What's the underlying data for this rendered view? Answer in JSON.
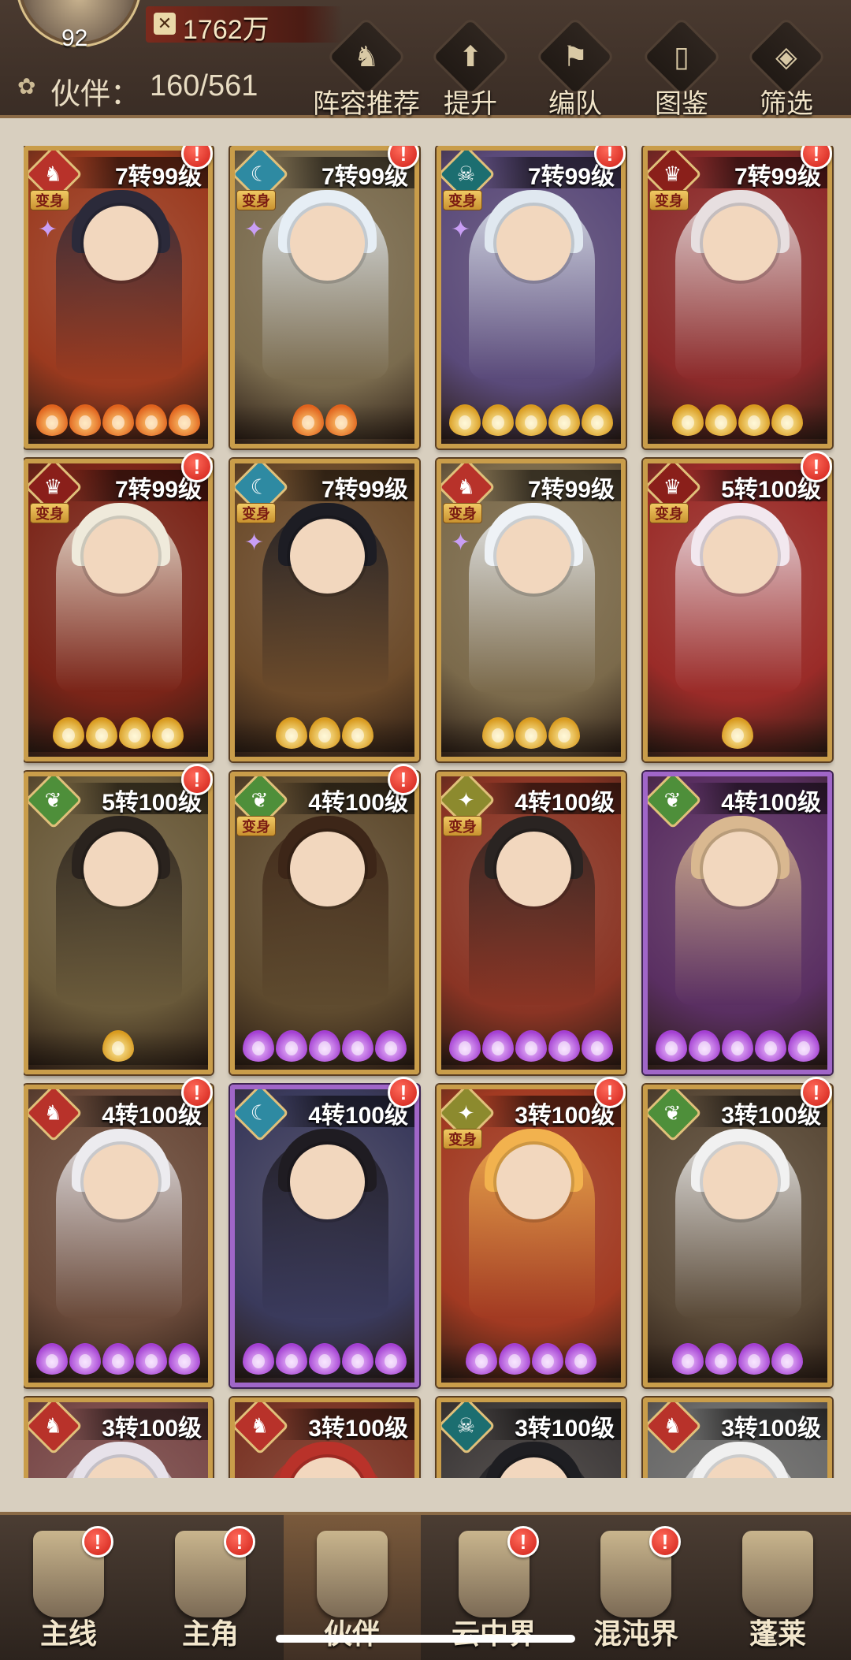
{
  "header": {
    "player_level": "92",
    "power": "1762万",
    "partners_label": "伙伴：",
    "partners_count": "160/561",
    "toolbar": [
      {
        "label": "阵容推荐",
        "icon": "formation-recommend-icon",
        "glyph": "♞"
      },
      {
        "label": "提升",
        "icon": "upgrade-icon",
        "glyph": "⬆"
      },
      {
        "label": "编队",
        "icon": "team-icon",
        "glyph": "⚑"
      },
      {
        "label": "图鉴",
        "icon": "codex-icon",
        "glyph": "▯"
      },
      {
        "label": "筛选",
        "icon": "filter-icon",
        "glyph": "◈"
      }
    ]
  },
  "cards": [
    {
      "level": "7转99级",
      "element": "fox",
      "transform": true,
      "sparkle": true,
      "flames": 5,
      "flame_color": "orange",
      "alert": true,
      "theme": "#9b3a1f",
      "hair": "#2b2a3a"
    },
    {
      "level": "7转99级",
      "element": "moon",
      "transform": true,
      "sparkle": true,
      "flames": 2,
      "flame_color": "orange",
      "alert": true,
      "theme": "#7a6b4e",
      "hair": "#e6eef5"
    },
    {
      "level": "7转99级",
      "element": "demon",
      "transform": true,
      "sparkle": true,
      "flames": 5,
      "flame_color": "gold",
      "alert": true,
      "theme": "#5a4a7a",
      "hair": "#e0e8f0"
    },
    {
      "level": "7转99级",
      "element": "beast",
      "transform": true,
      "sparkle": false,
      "flames": 4,
      "flame_color": "gold",
      "alert": true,
      "theme": "#8c2a2a",
      "hair": "#e7dfe0"
    },
    {
      "level": "7转99级",
      "element": "beast",
      "transform": true,
      "sparkle": false,
      "flames": 4,
      "flame_color": "gold",
      "alert": true,
      "theme": "#7a2418",
      "hair": "#efeadb"
    },
    {
      "level": "7转99级",
      "element": "moon",
      "transform": true,
      "sparkle": true,
      "flames": 3,
      "flame_color": "gold",
      "alert": false,
      "theme": "#6b4a2a",
      "hair": "#1d1d24"
    },
    {
      "level": "7转99级",
      "element": "fox",
      "transform": true,
      "sparkle": true,
      "flames": 3,
      "flame_color": "gold",
      "alert": false,
      "theme": "#7b6a4b",
      "hair": "#eef2f6"
    },
    {
      "level": "5转100级",
      "element": "beast",
      "transform": true,
      "sparkle": false,
      "flames": 1,
      "flame_color": "gold",
      "alert": true,
      "theme": "#9a2b28",
      "hair": "#f2e8ef"
    },
    {
      "level": "5转100级",
      "element": "leaf",
      "transform": false,
      "sparkle": false,
      "flames": 1,
      "flame_color": "gold",
      "alert": true,
      "theme": "#6a5a3a",
      "hair": "#2a231e"
    },
    {
      "level": "4转100级",
      "element": "leaf",
      "transform": true,
      "sparkle": false,
      "flames": 5,
      "flame_color": "purple",
      "alert": true,
      "theme": "#5e4a2e",
      "hair": "#3d2618"
    },
    {
      "level": "4转100级",
      "element": "gold",
      "transform": true,
      "sparkle": false,
      "flames": 5,
      "flame_color": "purple",
      "alert": false,
      "theme": "#8a3424",
      "hair": "#2a2422"
    },
    {
      "level": "4转100级",
      "element": "leaf",
      "transform": false,
      "sparkle": false,
      "flames": 5,
      "flame_color": "purple",
      "alert": false,
      "theme": "#5a2f62",
      "hair": "#d9b890",
      "purple": true
    },
    {
      "level": "4转100级",
      "element": "fox",
      "transform": false,
      "sparkle": false,
      "flames": 5,
      "flame_color": "purple",
      "alert": true,
      "theme": "#6a4a3a",
      "hair": "#ecebef"
    },
    {
      "level": "4转100级",
      "element": "moon",
      "transform": false,
      "sparkle": false,
      "flames": 5,
      "flame_color": "purple",
      "alert": true,
      "theme": "#3a3a5c",
      "hair": "#1f1c22",
      "purple": true
    },
    {
      "level": "3转100级",
      "element": "gold",
      "transform": true,
      "sparkle": false,
      "flames": 4,
      "flame_color": "purple",
      "alert": true,
      "theme": "#a23a22",
      "hair": "#f2b24e"
    },
    {
      "level": "3转100级",
      "element": "leaf",
      "transform": false,
      "sparkle": false,
      "flames": 4,
      "flame_color": "purple",
      "alert": true,
      "theme": "#5a4a38",
      "hair": "#f1f1f1"
    },
    {
      "level": "3转100级",
      "element": "fox",
      "transform": false,
      "sparkle": false,
      "flames": 0,
      "flame_color": "purple",
      "alert": false,
      "theme": "#7a4a4a",
      "hair": "#e7e2ea"
    },
    {
      "level": "3转100级",
      "element": "fox",
      "transform": false,
      "sparkle": false,
      "flames": 0,
      "flame_color": "purple",
      "alert": false,
      "theme": "#7a3526",
      "hair": "#b9322a"
    },
    {
      "level": "3转100级",
      "element": "demon",
      "transform": false,
      "sparkle": false,
      "flames": 0,
      "flame_color": "purple",
      "alert": false,
      "theme": "#3e3a3a",
      "hair": "#1e1e22"
    },
    {
      "level": "3转100级",
      "element": "fox",
      "transform": false,
      "sparkle": false,
      "flames": 0,
      "flame_color": "purple",
      "alert": false,
      "theme": "#6a6a6a",
      "hair": "#f0f0f0"
    }
  ],
  "ui": {
    "transform_tag": "变身"
  },
  "bottom_nav": [
    {
      "label": "主线",
      "icon": "main-story-icon",
      "alert": true,
      "active": false
    },
    {
      "label": "主角",
      "icon": "protagonist-icon",
      "alert": true,
      "active": false
    },
    {
      "label": "伙伴",
      "icon": "partners-icon",
      "alert": false,
      "active": true
    },
    {
      "label": "云中界",
      "icon": "cloud-realm-icon",
      "alert": true,
      "active": false
    },
    {
      "label": "混沌界",
      "icon": "chaos-realm-icon",
      "alert": true,
      "active": false
    },
    {
      "label": "蓬莱",
      "icon": "penglai-icon",
      "alert": false,
      "active": false
    }
  ]
}
